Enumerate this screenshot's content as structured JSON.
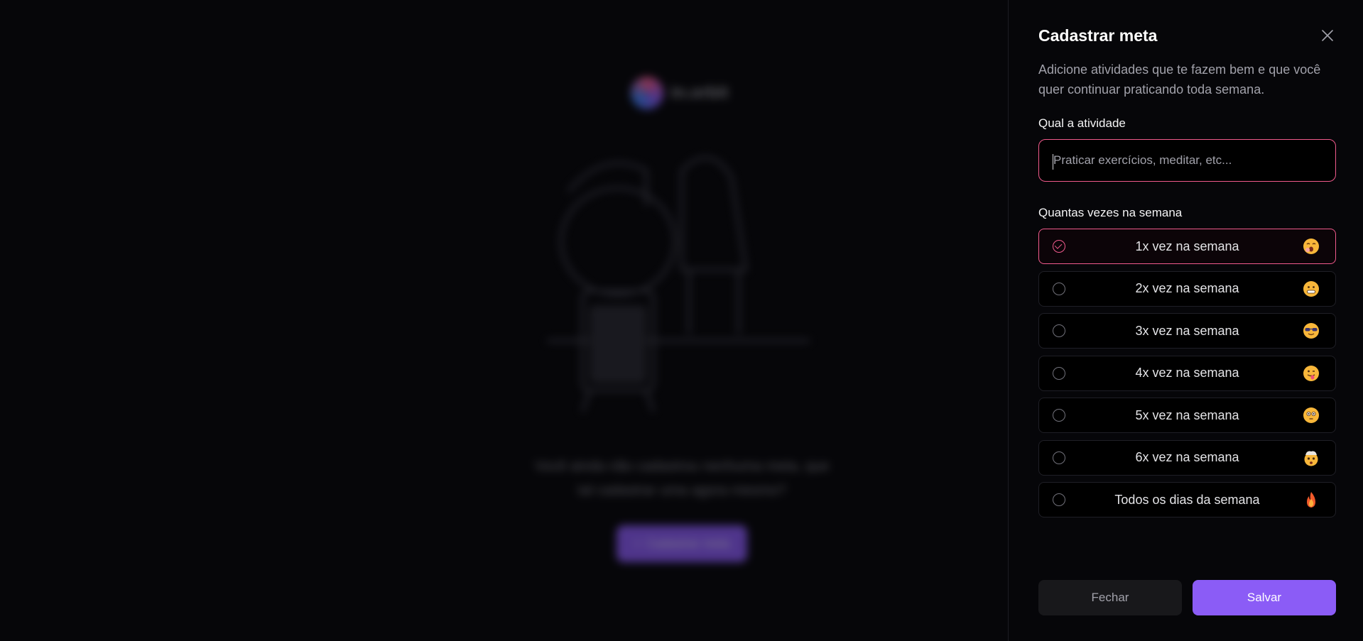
{
  "background": {
    "logo_text": "in.orbit",
    "empty_text": "Você ainda não cadastrou nenhuma meta, que tal cadastrar uma agora mesmo?",
    "cta_label": "Cadastrar meta"
  },
  "dialog": {
    "title": "Cadastrar meta",
    "description": "Adicione atividades que te fazem bem e que você quer continuar praticando toda semana.",
    "activity_label": "Qual a atividade",
    "activity_placeholder": "Praticar exercícios, meditar, etc...",
    "activity_value": "",
    "frequency_label": "Quantas vezes na semana",
    "options": [
      {
        "label": "1x vez na semana",
        "emoji": "yawning-face-icon",
        "selected": true
      },
      {
        "label": "2x vez na semana",
        "emoji": "grimacing-face-icon",
        "selected": false
      },
      {
        "label": "3x vez na semana",
        "emoji": "sunglasses-face-icon",
        "selected": false
      },
      {
        "label": "4x vez na semana",
        "emoji": "tongue-face-icon",
        "selected": false
      },
      {
        "label": "5x vez na semana",
        "emoji": "flushed-face-icon",
        "selected": false
      },
      {
        "label": "6x vez na semana",
        "emoji": "exploding-head-icon",
        "selected": false
      },
      {
        "label": "Todos os dias da semana",
        "emoji": "fire-icon",
        "selected": false
      }
    ],
    "close_label": "Fechar",
    "save_label": "Salvar"
  },
  "colors": {
    "accent_pink": "#f05a8c",
    "accent_violet": "#8b5cf6",
    "background": "#060609"
  }
}
